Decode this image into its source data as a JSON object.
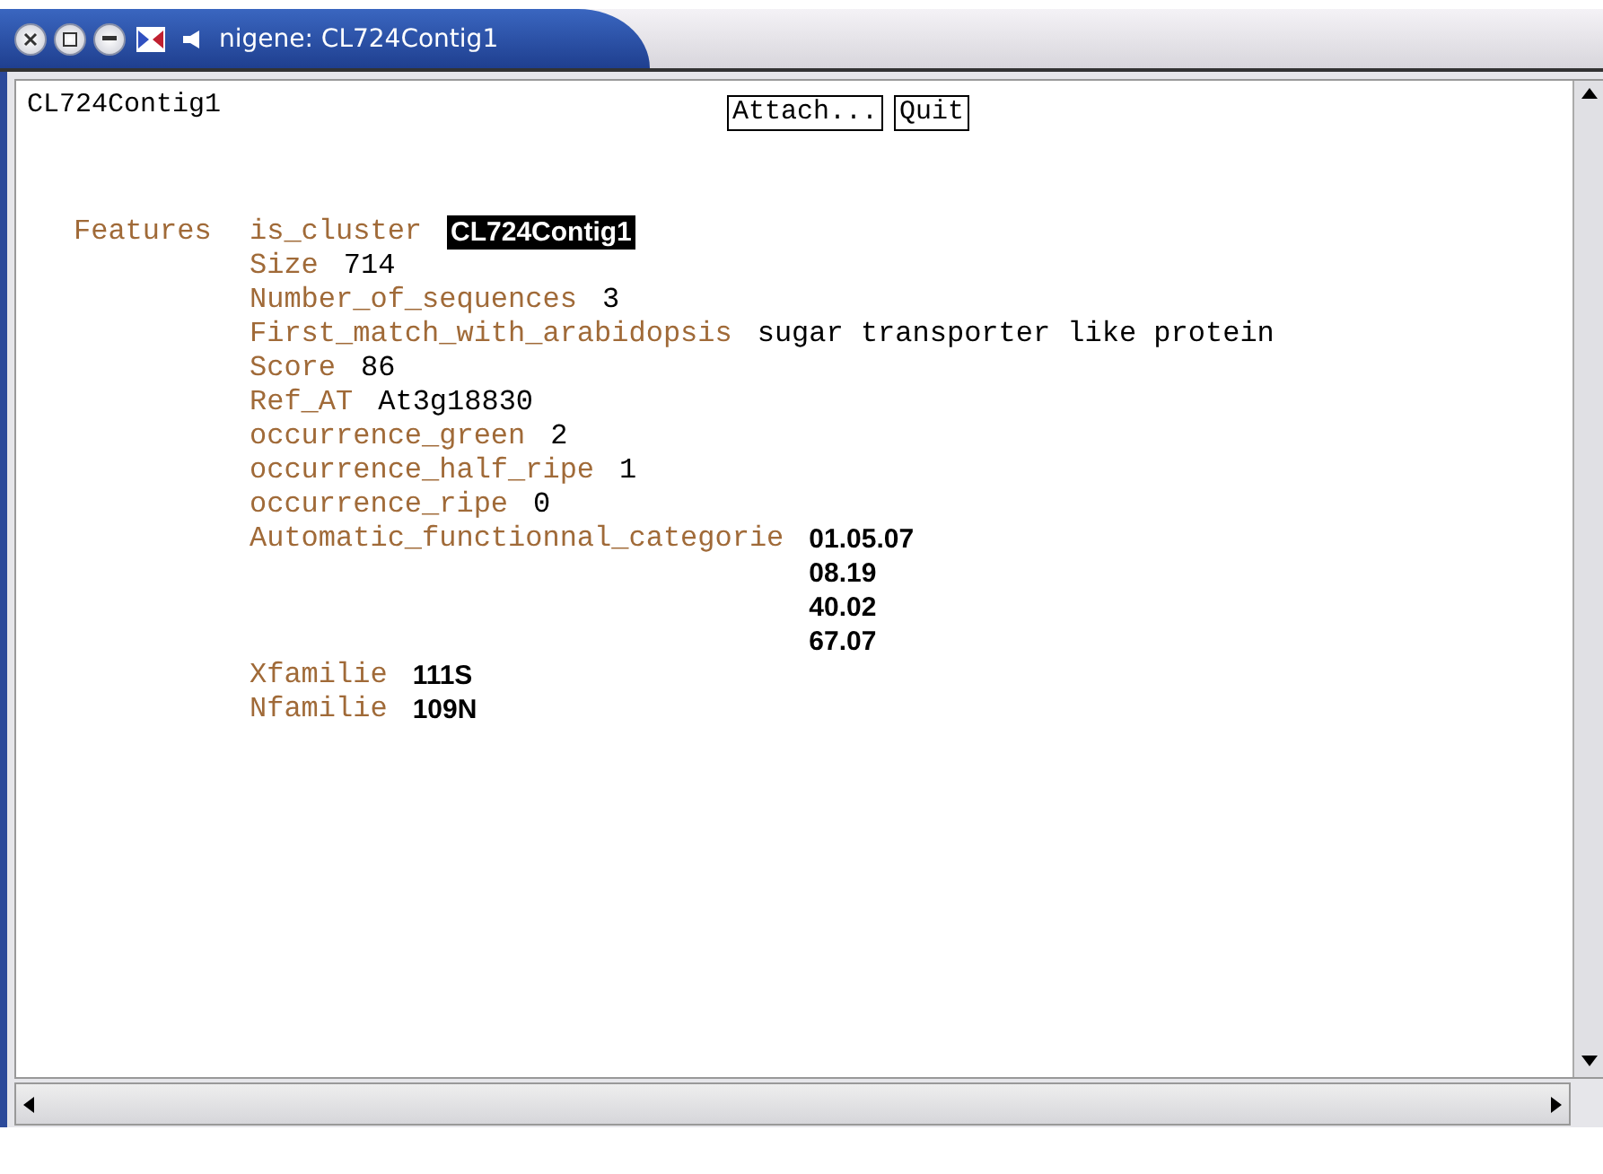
{
  "window": {
    "title": "nigene: CL724Contig1"
  },
  "header": {
    "name": "CL724Contig1",
    "buttons": [
      "Attach...",
      "Quit"
    ]
  },
  "section": {
    "label": "Features",
    "fields": [
      {
        "key": "is_cluster",
        "values": [
          "CL724Contig1"
        ],
        "highlighted": true,
        "bold": true
      },
      {
        "key": "Size",
        "values": [
          "714"
        ],
        "highlighted": false,
        "bold": false
      },
      {
        "key": "Number_of_sequences",
        "values": [
          "3"
        ],
        "highlighted": false,
        "bold": false
      },
      {
        "key": "First_match_with_arabidopsis",
        "values": [
          "sugar transporter like protein"
        ],
        "highlighted": false,
        "bold": false
      },
      {
        "key": "Score",
        "values": [
          "86"
        ],
        "highlighted": false,
        "bold": false
      },
      {
        "key": "Ref_AT",
        "values": [
          "At3g18830"
        ],
        "highlighted": false,
        "bold": false
      },
      {
        "key": "occurrence_green",
        "values": [
          "2"
        ],
        "highlighted": false,
        "bold": false
      },
      {
        "key": "occurrence_half_ripe",
        "values": [
          "1"
        ],
        "highlighted": false,
        "bold": false
      },
      {
        "key": "occurrence_ripe",
        "values": [
          "0"
        ],
        "highlighted": false,
        "bold": false
      },
      {
        "key": "Automatic_functionnal_categorie",
        "values": [
          "01.05.07",
          "08.19",
          "40.02",
          "67.07"
        ],
        "highlighted": false,
        "bold": true
      },
      {
        "key": "Xfamilie",
        "values": [
          "111S"
        ],
        "highlighted": false,
        "bold": true
      },
      {
        "key": "Nfamilie",
        "values": [
          "109N"
        ],
        "highlighted": false,
        "bold": true
      }
    ]
  }
}
